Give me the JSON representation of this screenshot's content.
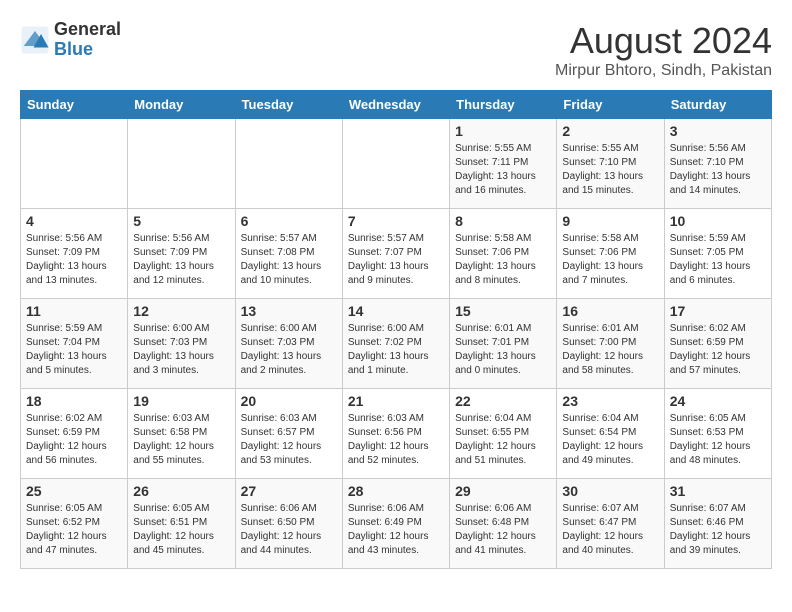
{
  "header": {
    "logo_general": "General",
    "logo_blue": "Blue",
    "month": "August 2024",
    "location": "Mirpur Bhtoro, Sindh, Pakistan"
  },
  "days_of_week": [
    "Sunday",
    "Monday",
    "Tuesday",
    "Wednesday",
    "Thursday",
    "Friday",
    "Saturday"
  ],
  "weeks": [
    [
      {
        "day": "",
        "info": ""
      },
      {
        "day": "",
        "info": ""
      },
      {
        "day": "",
        "info": ""
      },
      {
        "day": "",
        "info": ""
      },
      {
        "day": "1",
        "info": "Sunrise: 5:55 AM\nSunset: 7:11 PM\nDaylight: 13 hours\nand 16 minutes."
      },
      {
        "day": "2",
        "info": "Sunrise: 5:55 AM\nSunset: 7:10 PM\nDaylight: 13 hours\nand 15 minutes."
      },
      {
        "day": "3",
        "info": "Sunrise: 5:56 AM\nSunset: 7:10 PM\nDaylight: 13 hours\nand 14 minutes."
      }
    ],
    [
      {
        "day": "4",
        "info": "Sunrise: 5:56 AM\nSunset: 7:09 PM\nDaylight: 13 hours\nand 13 minutes."
      },
      {
        "day": "5",
        "info": "Sunrise: 5:56 AM\nSunset: 7:09 PM\nDaylight: 13 hours\nand 12 minutes."
      },
      {
        "day": "6",
        "info": "Sunrise: 5:57 AM\nSunset: 7:08 PM\nDaylight: 13 hours\nand 10 minutes."
      },
      {
        "day": "7",
        "info": "Sunrise: 5:57 AM\nSunset: 7:07 PM\nDaylight: 13 hours\nand 9 minutes."
      },
      {
        "day": "8",
        "info": "Sunrise: 5:58 AM\nSunset: 7:06 PM\nDaylight: 13 hours\nand 8 minutes."
      },
      {
        "day": "9",
        "info": "Sunrise: 5:58 AM\nSunset: 7:06 PM\nDaylight: 13 hours\nand 7 minutes."
      },
      {
        "day": "10",
        "info": "Sunrise: 5:59 AM\nSunset: 7:05 PM\nDaylight: 13 hours\nand 6 minutes."
      }
    ],
    [
      {
        "day": "11",
        "info": "Sunrise: 5:59 AM\nSunset: 7:04 PM\nDaylight: 13 hours\nand 5 minutes."
      },
      {
        "day": "12",
        "info": "Sunrise: 6:00 AM\nSunset: 7:03 PM\nDaylight: 13 hours\nand 3 minutes."
      },
      {
        "day": "13",
        "info": "Sunrise: 6:00 AM\nSunset: 7:03 PM\nDaylight: 13 hours\nand 2 minutes."
      },
      {
        "day": "14",
        "info": "Sunrise: 6:00 AM\nSunset: 7:02 PM\nDaylight: 13 hours\nand 1 minute."
      },
      {
        "day": "15",
        "info": "Sunrise: 6:01 AM\nSunset: 7:01 PM\nDaylight: 13 hours\nand 0 minutes."
      },
      {
        "day": "16",
        "info": "Sunrise: 6:01 AM\nSunset: 7:00 PM\nDaylight: 12 hours\nand 58 minutes."
      },
      {
        "day": "17",
        "info": "Sunrise: 6:02 AM\nSunset: 6:59 PM\nDaylight: 12 hours\nand 57 minutes."
      }
    ],
    [
      {
        "day": "18",
        "info": "Sunrise: 6:02 AM\nSunset: 6:59 PM\nDaylight: 12 hours\nand 56 minutes."
      },
      {
        "day": "19",
        "info": "Sunrise: 6:03 AM\nSunset: 6:58 PM\nDaylight: 12 hours\nand 55 minutes."
      },
      {
        "day": "20",
        "info": "Sunrise: 6:03 AM\nSunset: 6:57 PM\nDaylight: 12 hours\nand 53 minutes."
      },
      {
        "day": "21",
        "info": "Sunrise: 6:03 AM\nSunset: 6:56 PM\nDaylight: 12 hours\nand 52 minutes."
      },
      {
        "day": "22",
        "info": "Sunrise: 6:04 AM\nSunset: 6:55 PM\nDaylight: 12 hours\nand 51 minutes."
      },
      {
        "day": "23",
        "info": "Sunrise: 6:04 AM\nSunset: 6:54 PM\nDaylight: 12 hours\nand 49 minutes."
      },
      {
        "day": "24",
        "info": "Sunrise: 6:05 AM\nSunset: 6:53 PM\nDaylight: 12 hours\nand 48 minutes."
      }
    ],
    [
      {
        "day": "25",
        "info": "Sunrise: 6:05 AM\nSunset: 6:52 PM\nDaylight: 12 hours\nand 47 minutes."
      },
      {
        "day": "26",
        "info": "Sunrise: 6:05 AM\nSunset: 6:51 PM\nDaylight: 12 hours\nand 45 minutes."
      },
      {
        "day": "27",
        "info": "Sunrise: 6:06 AM\nSunset: 6:50 PM\nDaylight: 12 hours\nand 44 minutes."
      },
      {
        "day": "28",
        "info": "Sunrise: 6:06 AM\nSunset: 6:49 PM\nDaylight: 12 hours\nand 43 minutes."
      },
      {
        "day": "29",
        "info": "Sunrise: 6:06 AM\nSunset: 6:48 PM\nDaylight: 12 hours\nand 41 minutes."
      },
      {
        "day": "30",
        "info": "Sunrise: 6:07 AM\nSunset: 6:47 PM\nDaylight: 12 hours\nand 40 minutes."
      },
      {
        "day": "31",
        "info": "Sunrise: 6:07 AM\nSunset: 6:46 PM\nDaylight: 12 hours\nand 39 minutes."
      }
    ]
  ]
}
